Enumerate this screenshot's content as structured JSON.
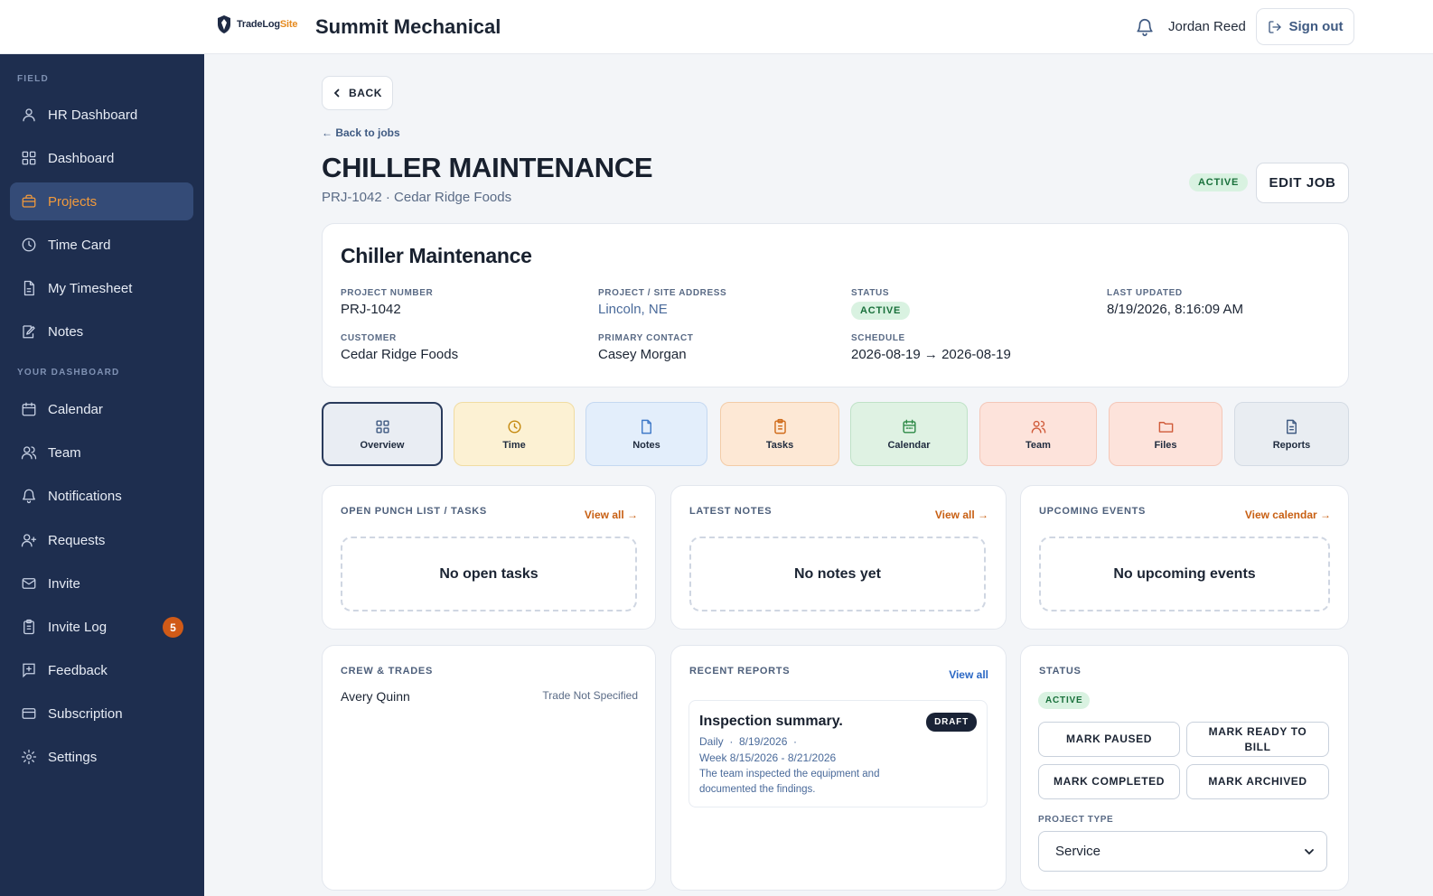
{
  "header": {
    "logo_main": "TradeLog",
    "logo_accent": "Site",
    "company": "Summit Mechanical",
    "user": "Jordan Reed",
    "sign_out": "Sign out"
  },
  "sidebar": {
    "section_field": "FIELD",
    "section_dashboard": "YOUR DASHBOARD",
    "items": [
      {
        "label": "HR Dashboard",
        "icon": "user-icon"
      },
      {
        "label": "Dashboard",
        "icon": "grid-icon"
      },
      {
        "label": "Projects",
        "icon": "briefcase-icon"
      },
      {
        "label": "Time Card",
        "icon": "clock-icon"
      },
      {
        "label": "My Timesheet",
        "icon": "file-icon"
      },
      {
        "label": "Notes",
        "icon": "edit-icon"
      },
      {
        "label": "Calendar",
        "icon": "calendar-icon"
      },
      {
        "label": "Team",
        "icon": "team-icon"
      },
      {
        "label": "Notifications",
        "icon": "bell-icon"
      },
      {
        "label": "Requests",
        "icon": "user-plus-icon"
      },
      {
        "label": "Invite",
        "icon": "mail-icon"
      },
      {
        "label": "Invite Log",
        "icon": "clipboard-icon",
        "badge": "5"
      },
      {
        "label": "Feedback",
        "icon": "feedback-icon"
      },
      {
        "label": "Subscription",
        "icon": "card-icon"
      },
      {
        "label": "Settings",
        "icon": "gear-icon"
      }
    ]
  },
  "page": {
    "back": "BACK",
    "back_link": "← Back to jobs",
    "title": "CHILLER MAINTENANCE",
    "subtitle": "PRJ-1042 · Cedar Ridge Foods",
    "status": "ACTIVE",
    "edit": "EDIT JOB"
  },
  "info": {
    "title": "Chiller Maintenance",
    "project_number_label": "PROJECT NUMBER",
    "project_number": "PRJ-1042",
    "address_label": "PROJECT / SITE ADDRESS",
    "address": "Lincoln, NE",
    "status_label": "STATUS",
    "status": "ACTIVE",
    "updated_label": "LAST UPDATED",
    "updated": "8/19/2026, 8:16:09 AM",
    "customer_label": "CUSTOMER",
    "customer": "Cedar Ridge Foods",
    "contact_label": "PRIMARY CONTACT",
    "contact": "Casey Morgan",
    "schedule_label": "SCHEDULE",
    "schedule": "2026-08-19 → 2026-08-19"
  },
  "tabs": [
    {
      "label": "Overview",
      "icon": "grid-icon",
      "bg": "#e9edf3",
      "border": "#2a3b5c",
      "fg": "#3f5a82"
    },
    {
      "label": "Time",
      "icon": "clock-icon",
      "bg": "#fcf1d3",
      "border": "#f0dca2",
      "fg": "#c58a10"
    },
    {
      "label": "Notes",
      "icon": "file-icon",
      "bg": "#e3eefb",
      "border": "#c4d8f1",
      "fg": "#3f79c8"
    },
    {
      "label": "Tasks",
      "icon": "clipboard-icon",
      "bg": "#fde8d5",
      "border": "#f3cca7",
      "fg": "#d06b1a"
    },
    {
      "label": "Calendar",
      "icon": "calendar-icon",
      "bg": "#dff2e3",
      "border": "#bfe2c7",
      "fg": "#2e8a47"
    },
    {
      "label": "Team",
      "icon": "team-icon",
      "bg": "#fde3db",
      "border": "#f4c7b8",
      "fg": "#d05b3a"
    },
    {
      "label": "Files",
      "icon": "folder-icon",
      "bg": "#fde3db",
      "border": "#f4c7b8",
      "fg": "#d05b3a"
    },
    {
      "label": "Reports",
      "icon": "file-icon",
      "bg": "#e9edf2",
      "border": "#d4dbe4",
      "fg": "#3f5a82"
    }
  ],
  "sections": {
    "tasks_label": "OPEN PUNCH LIST / TASKS",
    "tasks_link": "View all →",
    "tasks_empty": "No open tasks",
    "notes_label": "LATEST NOTES",
    "notes_link": "View all →",
    "notes_empty": "No notes yet",
    "events_label": "UPCOMING EVENTS",
    "events_link": "View calendar →",
    "events_empty": "No upcoming events",
    "crew_label": "CREW & TRADES",
    "crew_name": "Avery Quinn",
    "crew_trade": "Trade Not Specified",
    "reports_label": "RECENT REPORTS",
    "reports_link": "View all",
    "report_title": "Inspection summary.",
    "report_badge": "DRAFT",
    "report_meta": "Daily  ·  8/19/2026  ·",
    "report_week": "Week 8/15/2026 - 8/21/2026",
    "report_desc_1": "The team inspected the equipment and",
    "report_desc_2": "documented the findings.",
    "status_label": "STATUS",
    "status_value": "ACTIVE",
    "btn_paused": "MARK PAUSED",
    "btn_ready_1": "MARK READY TO",
    "btn_ready_2": "BILL",
    "btn_completed": "MARK COMPLETED",
    "btn_archived": "MARK ARCHIVED",
    "type_label": "PROJECT TYPE",
    "type_value": "Service"
  },
  "colors": {
    "sidebar_bg": "#1e2e4f",
    "accent_orange": "#f29a3c",
    "link_orange": "#c85f12",
    "link_blue": "#2a67c4"
  }
}
